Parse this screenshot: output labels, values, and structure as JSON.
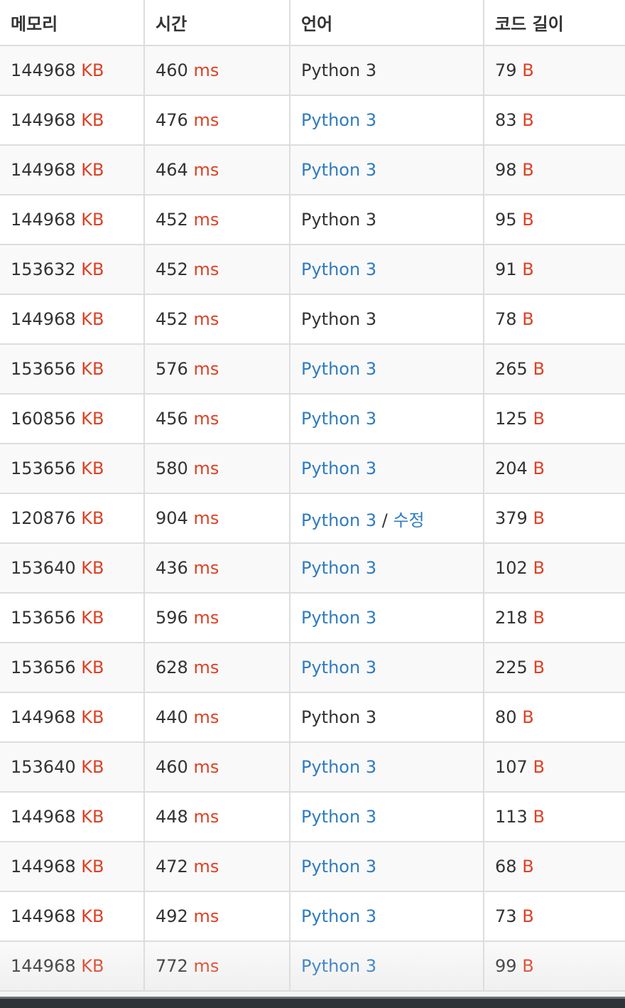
{
  "table": {
    "headers": {
      "memory": "메모리",
      "time": "시간",
      "language": "언어",
      "code_length": "코드 길이"
    },
    "units": {
      "memory": "KB",
      "time": "ms",
      "code_length": "B"
    },
    "rows": [
      {
        "memory": "144968",
        "time": "460",
        "language": "Python 3",
        "language_link": false,
        "edit": "",
        "code_length": "79"
      },
      {
        "memory": "144968",
        "time": "476",
        "language": "Python 3",
        "language_link": true,
        "edit": "",
        "code_length": "83"
      },
      {
        "memory": "144968",
        "time": "464",
        "language": "Python 3",
        "language_link": true,
        "edit": "",
        "code_length": "98"
      },
      {
        "memory": "144968",
        "time": "452",
        "language": "Python 3",
        "language_link": false,
        "edit": "",
        "code_length": "95"
      },
      {
        "memory": "153632",
        "time": "452",
        "language": "Python 3",
        "language_link": true,
        "edit": "",
        "code_length": "91"
      },
      {
        "memory": "144968",
        "time": "452",
        "language": "Python 3",
        "language_link": false,
        "edit": "",
        "code_length": "78"
      },
      {
        "memory": "153656",
        "time": "576",
        "language": "Python 3",
        "language_link": true,
        "edit": "",
        "code_length": "265"
      },
      {
        "memory": "160856",
        "time": "456",
        "language": "Python 3",
        "language_link": true,
        "edit": "",
        "code_length": "125"
      },
      {
        "memory": "153656",
        "time": "580",
        "language": "Python 3",
        "language_link": true,
        "edit": "",
        "code_length": "204"
      },
      {
        "memory": "120876",
        "time": "904",
        "language": "Python 3",
        "language_link": true,
        "edit": "수정",
        "code_length": "379"
      },
      {
        "memory": "153640",
        "time": "436",
        "language": "Python 3",
        "language_link": true,
        "edit": "",
        "code_length": "102"
      },
      {
        "memory": "153656",
        "time": "596",
        "language": "Python 3",
        "language_link": true,
        "edit": "",
        "code_length": "218"
      },
      {
        "memory": "153656",
        "time": "628",
        "language": "Python 3",
        "language_link": true,
        "edit": "",
        "code_length": "225"
      },
      {
        "memory": "144968",
        "time": "440",
        "language": "Python 3",
        "language_link": false,
        "edit": "",
        "code_length": "80"
      },
      {
        "memory": "153640",
        "time": "460",
        "language": "Python 3",
        "language_link": true,
        "edit": "",
        "code_length": "107"
      },
      {
        "memory": "144968",
        "time": "448",
        "language": "Python 3",
        "language_link": true,
        "edit": "",
        "code_length": "113"
      },
      {
        "memory": "144968",
        "time": "472",
        "language": "Python 3",
        "language_link": true,
        "edit": "",
        "code_length": "68"
      },
      {
        "memory": "144968",
        "time": "492",
        "language": "Python 3",
        "language_link": true,
        "edit": "",
        "code_length": "73"
      },
      {
        "memory": "144968",
        "time": "772",
        "language": "Python 3",
        "language_link": true,
        "edit": "",
        "code_length": "99"
      }
    ]
  },
  "colors": {
    "unit": "#dd4124",
    "link": "#2f7bc0",
    "text": "#333333",
    "row_stripe": "#f9f9f9",
    "border": "#dddddd"
  }
}
